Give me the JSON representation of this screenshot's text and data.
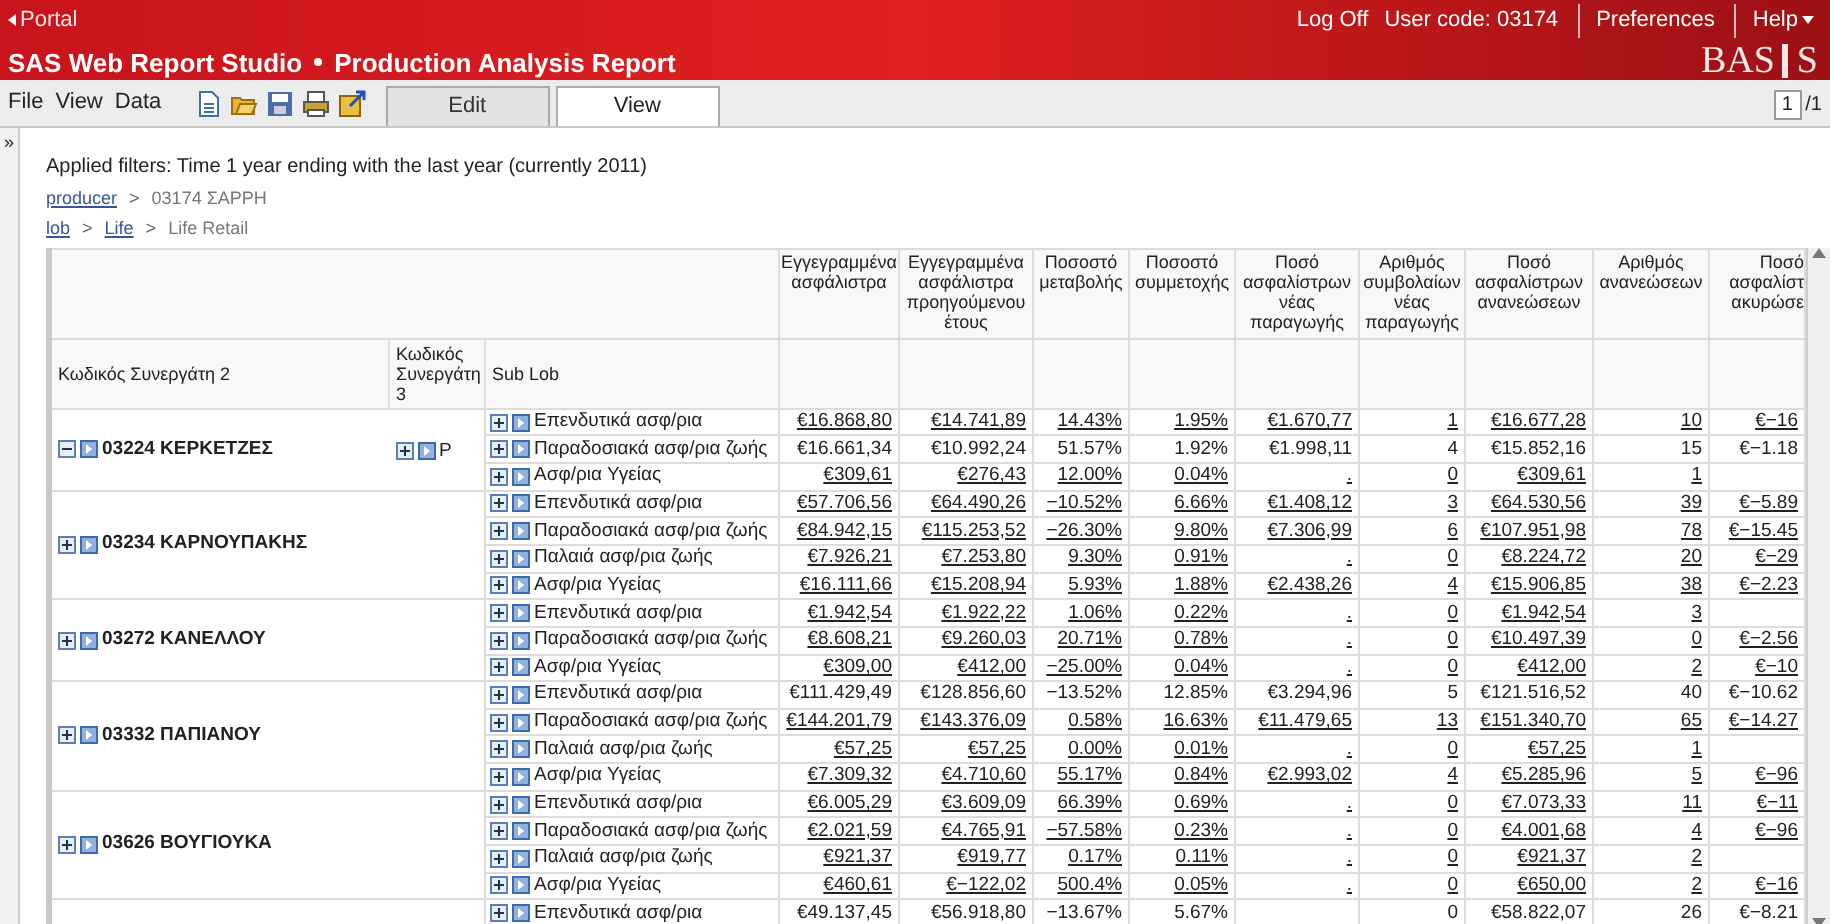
{
  "banner": {
    "portal_link": "Portal",
    "title": "SAS Web Report Studio",
    "subtitle": "Production Analysis Report",
    "links": [
      "Log Off",
      "User code: 03174",
      "Preferences",
      "Help"
    ],
    "logo": {
      "left": "BAS",
      "right": "S"
    }
  },
  "menu": [
    "File",
    "View",
    "Data"
  ],
  "tabs": [
    {
      "label": "Edit",
      "selected": false
    },
    {
      "label": "View",
      "selected": true
    }
  ],
  "page": {
    "value": "1",
    "total": "/1"
  },
  "side_toggle": "»",
  "filters": "Applied filters: Time 1 year ending with the last year (currently 2011)",
  "breadcrumbs": [
    {
      "separator": ">",
      "items": [
        {
          "label": "producer",
          "link": true
        },
        {
          "label": "03174 ΣΑΡΡΗ",
          "link": false
        }
      ]
    },
    {
      "separator": ">",
      "items": [
        {
          "label": "lob",
          "link": true
        },
        {
          "label": "Life",
          "link": true
        },
        {
          "label": "Life Retail",
          "link": false
        }
      ]
    }
  ],
  "table": {
    "left_columns": [
      "Κωδικός Συνεργάτη 2",
      "Κωδικός Συνεργάτη 3",
      "Sub Lob"
    ],
    "columns": [
      "Εγγεγραμμένα ασφάλιστρα",
      "Εγγεγραμμένα ασφάλιστρα προηγούμενου έτους",
      "Ποσοστό μεταβολής",
      "Ποσοστό συμμετοχής",
      "Ποσό ασφαλίστρων νέας παραγωγής",
      "Αριθμός συμβολαίων νέας παραγωγής",
      "Ποσό ασφαλίστρων ανανεώσεων",
      "Αριθμός ανανεώσεων",
      "Ποσό ασφαλίστ ακυρώσε"
    ],
    "groups": [
      {
        "partner": "03224 ΚΕΡΚΕΤΖΕΣ",
        "expanded": true,
        "code3": "P",
        "rows": [
          {
            "sub_lob": "Επενδυτικά ασφ/ρια",
            "linked": true,
            "written": "€16.868,80",
            "written_prev": "€14.741,89",
            "change": "14.43%",
            "share": "1.95%",
            "new_amount": "€1.670,77",
            "new_count": "1",
            "renewal_amount": "€16.677,28",
            "renewal_count": "10",
            "column_9": "€−16"
          },
          {
            "sub_lob": "Παραδοσιακά ασφ/ρια ζωής",
            "linked": false,
            "written": "€16.661,34",
            "written_prev": "€10.992,24",
            "change": "51.57%",
            "share": "1.92%",
            "new_amount": "€1.998,11",
            "new_count": "4",
            "renewal_amount": "€15.852,16",
            "renewal_count": "15",
            "column_9": "€−1.18"
          },
          {
            "sub_lob": "Ασφ/ρια Υγείας",
            "linked": true,
            "written": "€309,61",
            "written_prev": "€276,43",
            "change": "12.00%",
            "share": "0.04%",
            "new_amount": ".",
            "new_count": "0",
            "renewal_amount": "€309,61",
            "renewal_count": "1"
          }
        ]
      },
      {
        "partner": "03234 ΚΑΡΝΟΥΠΑΚΗΣ",
        "expanded": false,
        "rows": [
          {
            "sub_lob": "Επενδυτικά ασφ/ρια",
            "linked": true,
            "written": "€57.706,56",
            "written_prev": "€64.490,26",
            "change": "−10.52%",
            "share": "6.66%",
            "new_amount": "€1.408,12",
            "new_count": "3",
            "renewal_amount": "€64.530,56",
            "renewal_count": "39",
            "column_9": "€−5.89"
          },
          {
            "sub_lob": "Παραδοσιακά ασφ/ρια ζωής",
            "linked": true,
            "written": "€84.942,15",
            "written_prev": "€115.253,52",
            "change": "−26.30%",
            "share": "9.80%",
            "new_amount": "€7.306,99",
            "new_count": "6",
            "renewal_amount": "€107.951,98",
            "renewal_count": "78",
            "column_9": "€−15.45"
          },
          {
            "sub_lob": "Παλαιά ασφ/ρια ζωής",
            "linked": true,
            "written": "€7.926,21",
            "written_prev": "€7.253,80",
            "change": "9.30%",
            "share": "0.91%",
            "new_amount": ".",
            "new_count": "0",
            "renewal_amount": "€8.224,72",
            "renewal_count": "20",
            "column_9": "€−29"
          },
          {
            "sub_lob": "Ασφ/ρια Υγείας",
            "linked": true,
            "written": "€16.111,66",
            "written_prev": "€15.208,94",
            "change": "5.93%",
            "share": "1.88%",
            "new_amount": "€2.438,26",
            "new_count": "4",
            "renewal_amount": "€15.906,85",
            "renewal_count": "38",
            "column_9": "€−2.23"
          }
        ]
      },
      {
        "partner": "03272 ΚΑΝΕΛΛΟΥ",
        "expanded": false,
        "rows": [
          {
            "sub_lob": "Επενδυτικά ασφ/ρια",
            "linked": true,
            "written": "€1.942,54",
            "written_prev": "€1.922,22",
            "change": "1.06%",
            "share": "0.22%",
            "new_amount": ".",
            "new_count": "0",
            "renewal_amount": "€1.942,54",
            "renewal_count": "3"
          },
          {
            "sub_lob": "Παραδοσιακά ασφ/ρια ζωής",
            "linked": true,
            "written": "€8.608,21",
            "written_prev": "€9.260,03",
            "change": "20.71%",
            "share": "0.78%",
            "new_amount": ".",
            "new_count": "0",
            "renewal_amount": "€10.497,39",
            "renewal_count": "0",
            "column_9": "€−2.56"
          },
          {
            "sub_lob": "Ασφ/ρια Υγείας",
            "linked": true,
            "written": "€309,00",
            "written_prev": "€412,00",
            "change": "−25.00%",
            "share": "0.04%",
            "new_amount": ".",
            "new_count": "0",
            "renewal_amount": "€412,00",
            "renewal_count": "2",
            "column_9": "€−10"
          }
        ]
      },
      {
        "partner": "03332 ΠΑΠΙΑΝΟΥ",
        "expanded": false,
        "rows": [
          {
            "sub_lob": "Επενδυτικά ασφ/ρια",
            "linked": false,
            "written": "€111.429,49",
            "written_prev": "€128.856,60",
            "change": "−13.52%",
            "share": "12.85%",
            "new_amount": "€3.294,96",
            "new_count": "5",
            "renewal_amount": "€121.516,52",
            "renewal_count": "40",
            "column_9": "€−10.62"
          },
          {
            "sub_lob": "Παραδοσιακά ασφ/ρια ζωής",
            "linked": true,
            "written": "€144.201,79",
            "written_prev": "€143.376,09",
            "change": "0.58%",
            "share": "16.63%",
            "new_amount": "€11.479,65",
            "new_count": "13",
            "renewal_amount": "€151.340,70",
            "renewal_count": "65",
            "column_9": "€−14.27"
          },
          {
            "sub_lob": "Παλαιά ασφ/ρια ζωής",
            "linked": true,
            "written": "€57,25",
            "written_prev": "€57,25",
            "change": "0.00%",
            "share": "0.01%",
            "new_amount": ".",
            "new_count": "0",
            "renewal_amount": "€57,25",
            "renewal_count": "1"
          },
          {
            "sub_lob": "Ασφ/ρια Υγείας",
            "linked": true,
            "written": "€7.309,32",
            "written_prev": "€4.710,60",
            "change": "55.17%",
            "share": "0.84%",
            "new_amount": "€2.993,02",
            "new_count": "4",
            "renewal_amount": "€5.285,96",
            "renewal_count": "5",
            "column_9": "€−96"
          }
        ]
      },
      {
        "partner": "03626 ΒΟΥΓΙΟΥΚΑ",
        "expanded": false,
        "rows": [
          {
            "sub_lob": "Επενδυτικά ασφ/ρια",
            "linked": true,
            "written": "€6.005,29",
            "written_prev": "€3.609,09",
            "change": "66.39%",
            "share": "0.69%",
            "new_amount": ".",
            "new_count": "0",
            "renewal_amount": "€7.073,33",
            "renewal_count": "11",
            "column_9": "€−11"
          },
          {
            "sub_lob": "Παραδοσιακά ασφ/ρια ζωής",
            "linked": true,
            "written": "€2.021,59",
            "written_prev": "€4.765,91",
            "change": "−57.58%",
            "share": "0.23%",
            "new_amount": ".",
            "new_count": "0",
            "renewal_amount": "€4.001,68",
            "renewal_count": "4",
            "column_9": "€−96"
          },
          {
            "sub_lob": "Παλαιά ασφ/ρια ζωής",
            "linked": true,
            "written": "€921,37",
            "written_prev": "€919,77",
            "change": "0.17%",
            "share": "0.11%",
            "new_amount": ".",
            "new_count": "0",
            "renewal_amount": "€921,37",
            "renewal_count": "2"
          },
          {
            "sub_lob": "Ασφ/ρια Υγείας",
            "linked": true,
            "written": "€460,61",
            "written_prev": "€−122,02",
            "change": "500.4%",
            "share": "0.05%",
            "new_amount": ".",
            "new_count": "0",
            "renewal_amount": "€650,00",
            "renewal_count": "2",
            "column_9": "€−16"
          }
        ]
      },
      {
        "rows": [
          {
            "sub_lob": "Επενδυτικά ασφ/ρια",
            "linked": false,
            "written": "€49.137,45",
            "written_prev": "€56.918,80",
            "change": "−13.67%",
            "share": "5.67%",
            "new_count": "0",
            "renewal_amount": "€58.822,07",
            "renewal_count": "26",
            "column_9": "€−8.21"
          }
        ]
      }
    ]
  }
}
